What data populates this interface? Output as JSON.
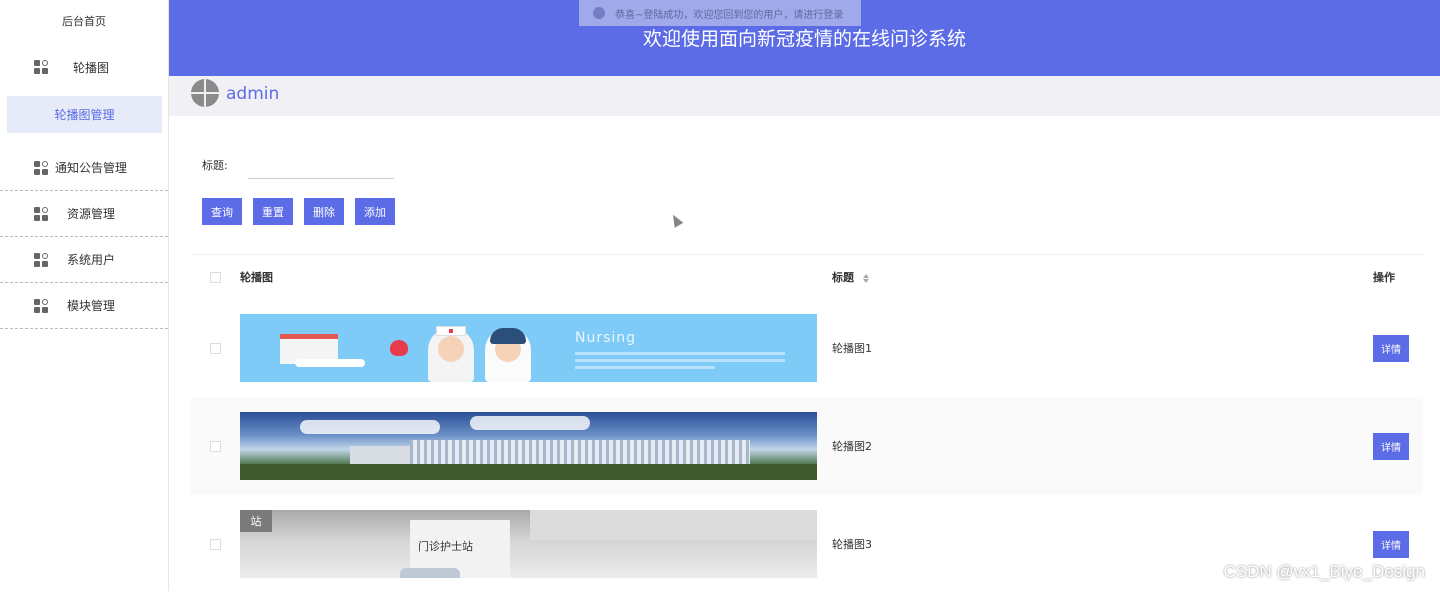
{
  "app": {
    "title": "欢迎使用面向新冠疫情的在线问诊系统",
    "toast": "恭喜~登陆成功，欢迎您回到您的用户，请进行登录",
    "username": "admin",
    "accent_color": "#5c6be6"
  },
  "sidebar": {
    "home": "后台首页",
    "items": [
      {
        "label": "轮播图",
        "icon": "grid-icon"
      },
      {
        "label": "通知公告管理",
        "icon": "grid-icon"
      },
      {
        "label": "资源管理",
        "icon": "grid-icon"
      },
      {
        "label": "系统用户",
        "icon": "grid-icon"
      },
      {
        "label": "模块管理",
        "icon": "grid-icon"
      }
    ],
    "active_sub": "轮播图管理"
  },
  "search": {
    "label": "标题:",
    "value": "",
    "placeholder": ""
  },
  "toolbar": {
    "query": "查询",
    "reset": "重置",
    "delete": "删除",
    "add": "添加"
  },
  "table": {
    "headers": {
      "image": "轮播图",
      "title": "标题",
      "op": "操作"
    },
    "rows": [
      {
        "title": "轮播图1",
        "banner_text": "Nursing",
        "action": "详情"
      },
      {
        "title": "轮播图2",
        "action": "详情"
      },
      {
        "title": "轮播图3",
        "banner_text": "门诊护士站",
        "sign_text": "站",
        "action": "详情"
      }
    ]
  },
  "watermark": "CSDN @vx1_Biye_Design"
}
